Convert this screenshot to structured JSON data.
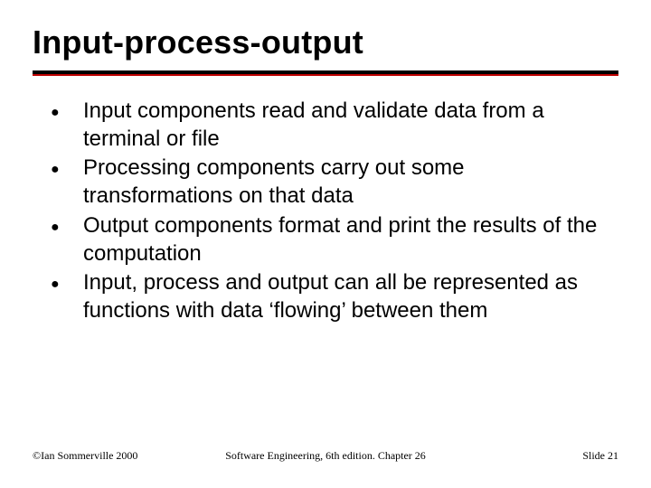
{
  "title": "Input-process-output",
  "bullets": [
    "Input components read and validate data from a terminal or file",
    "Processing components carry out some transformations on that data",
    "Output components format and print the results of the computation",
    "Input, process and output can all be represented as functions with data ‘flowing’ between them"
  ],
  "footer": {
    "left": "©Ian Sommerville 2000",
    "center": "Software Engineering, 6th edition. Chapter 26",
    "right": "Slide 21"
  }
}
